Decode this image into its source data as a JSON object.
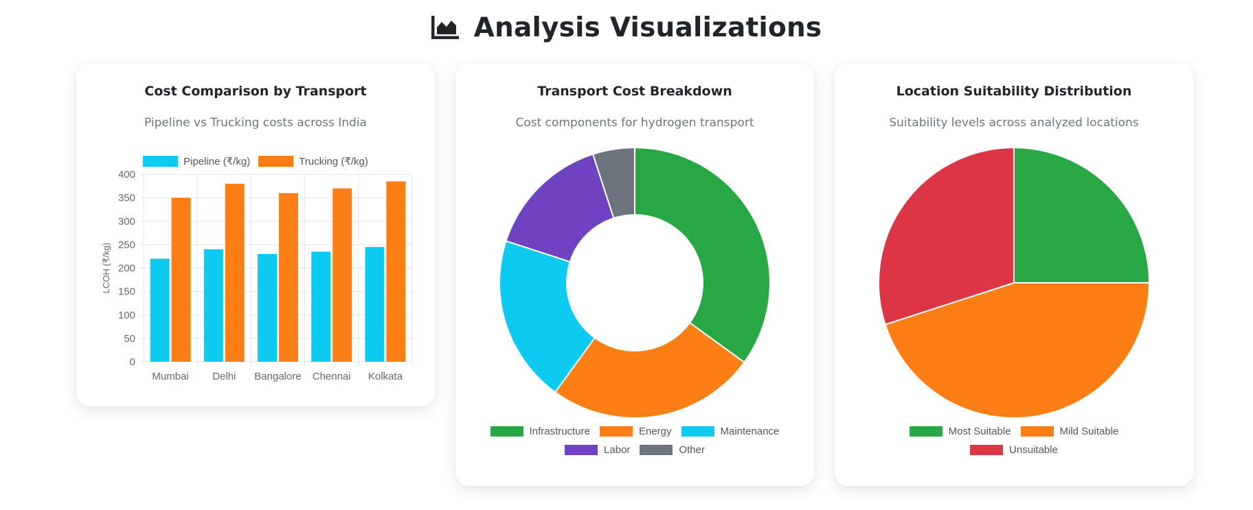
{
  "page": {
    "title": "Analysis Visualizations",
    "icon": "area-chart-icon"
  },
  "colors": {
    "cyan": "#0dcaf0",
    "orange": "#fd7e14",
    "green": "#28a745",
    "purple": "#6f42c1",
    "gray": "#6c757d",
    "red": "#dc3545"
  },
  "charts": {
    "cost_comparison": {
      "title": "Cost Comparison by Transport",
      "subtitle": "Pipeline vs Trucking costs across India"
    },
    "transport_breakdown": {
      "title": "Transport Cost Breakdown",
      "subtitle": "Cost components for hydrogen transport"
    },
    "suitability": {
      "title": "Location Suitability Distribution",
      "subtitle": "Suitability levels across analyzed locations"
    }
  },
  "chart_data": [
    {
      "type": "bar",
      "title": "Cost Comparison by Transport",
      "categories": [
        "Mumbai",
        "Delhi",
        "Bangalore",
        "Chennai",
        "Kolkata"
      ],
      "series": [
        {
          "name": "Pipeline (₹/kg)",
          "color": "#0dcaf0",
          "values": [
            220,
            240,
            230,
            235,
            245
          ]
        },
        {
          "name": "Trucking (₹/kg)",
          "color": "#fd7e14",
          "values": [
            350,
            380,
            360,
            370,
            385
          ]
        }
      ],
      "xlabel": "",
      "ylabel": "LCOH (₹/kg)",
      "ylim": [
        0,
        400
      ],
      "yticks": [
        0,
        50,
        100,
        150,
        200,
        250,
        300,
        350,
        400
      ],
      "grid": true,
      "legend": "top"
    },
    {
      "type": "pie",
      "variant": "doughnut",
      "title": "Transport Cost Breakdown",
      "labels": [
        "Infrastructure",
        "Energy",
        "Maintenance",
        "Labor",
        "Other"
      ],
      "values": [
        35,
        25,
        20,
        15,
        5
      ],
      "colors": [
        "#28a745",
        "#fd7e14",
        "#0dcaf0",
        "#6f42c1",
        "#6c757d"
      ],
      "legend": "bottom"
    },
    {
      "type": "pie",
      "title": "Location Suitability Distribution",
      "labels": [
        "Most Suitable",
        "Mild Suitable",
        "Unsuitable"
      ],
      "values": [
        25,
        45,
        30
      ],
      "colors": [
        "#28a745",
        "#fd7e14",
        "#dc3545"
      ],
      "legend": "bottom"
    }
  ]
}
